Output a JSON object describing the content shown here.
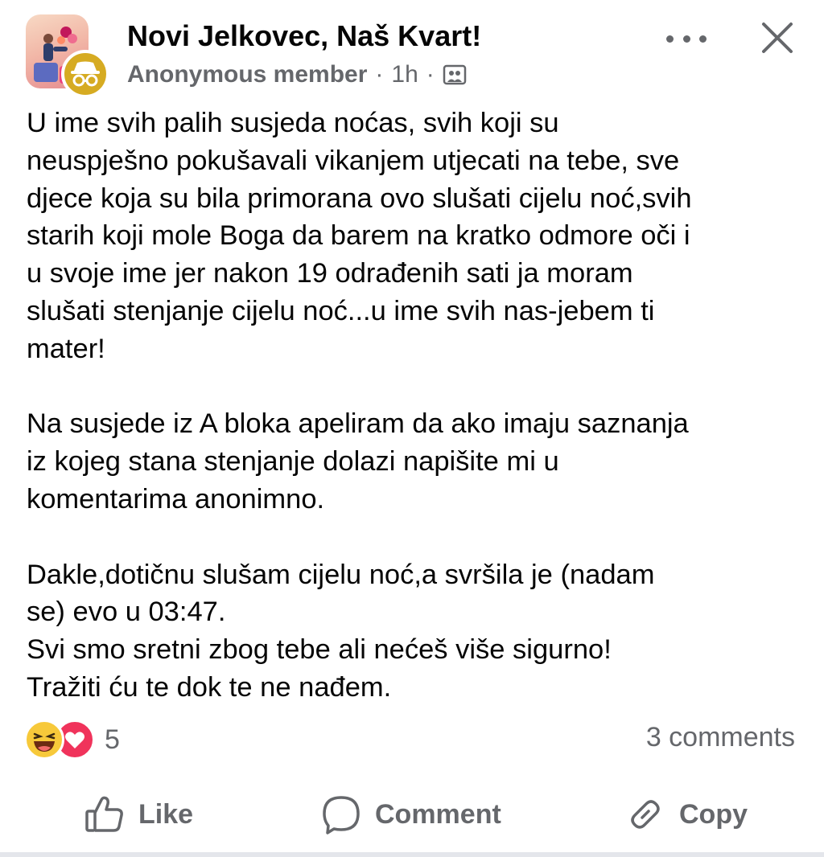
{
  "post": {
    "group_name": "Novi Jelkovec, Naš Kvart!",
    "author": "Anonymous member",
    "separator": "·",
    "time": "1h",
    "privacy_icon": "group-members-icon",
    "paragraphs": [
      "U ime svih palih susjeda noćas, svih koji su\nneuspješno pokušavali vikanjem utjecati na tebe, sve\ndjece koja su bila primorana ovo slušati cijelu noć,svih\nstarih koji mole Boga da barem na kratko odmore oči i\nu svoje ime jer nakon 19 odrađenih sati ja moram\nslušati stenjanje cijelu noć...u ime svih nas-jebem ti\nmater!",
      "Na susjede iz A bloka apeliram da ako imaju saznanja\niz kojeg stana stenjanje dolazi napišite mi u\nkomentarima anonimno.",
      "Dakle,dotičnu slušam cijelu noć,a svršila je (nadam\nse) evo u 03:47.\nSvi smo sretni zbog tebe ali nećeš više sigurno!\nTražiti ću te dok te ne nađem."
    ]
  },
  "reactions": {
    "icons": [
      "haha-reaction-icon",
      "love-reaction-icon"
    ],
    "count": "5",
    "comments": "3 comments"
  },
  "actions": {
    "like": "Like",
    "comment": "Comment",
    "copy": "Copy"
  },
  "colors": {
    "text_primary": "#050505",
    "text_secondary": "#65676b",
    "haha": "#f7c93a",
    "love": "#f0335b",
    "anon_badge": "#d6ab22"
  }
}
